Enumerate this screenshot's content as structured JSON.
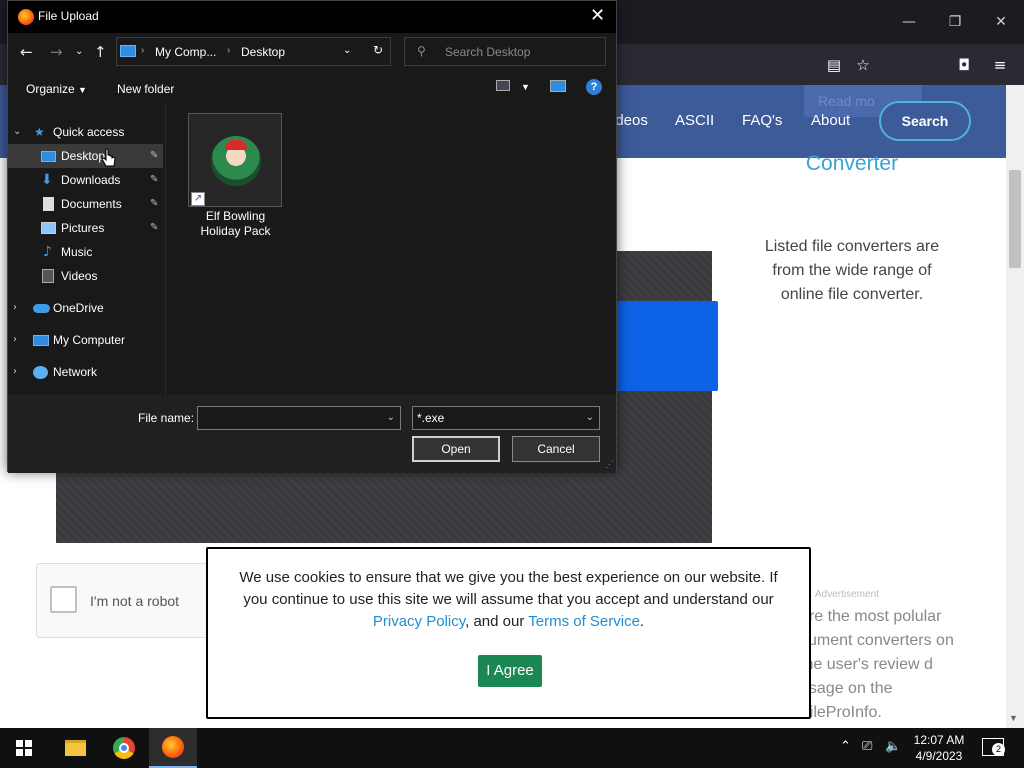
{
  "browser": {
    "window_controls": {
      "minimize": "—",
      "restore": "❐",
      "close": "✕"
    },
    "toolbar_icons": [
      "reader-view-icon",
      "bookmark-star-icon",
      "pocket-icon",
      "menu-icon"
    ]
  },
  "site": {
    "ghost_button": "Read mo",
    "nav": [
      "ideos",
      "ASCII",
      "FAQ's",
      "About"
    ],
    "search_label": "Search",
    "hero_title": "Converter",
    "hero_text": "Listed file converters are from the wide range of online file converter.",
    "ad_label": "Advertisement",
    "ad_text": "are the most polular cument converters on the user's review d usage on the FileProInfo.",
    "recaptcha_label": "I'm not a robot"
  },
  "cookie": {
    "text_part1": "We use cookies to ensure that we give you the best experience on our website. If you continue to use this site we will assume that you accept and understand our ",
    "privacy_link": "Privacy Policy",
    "text_part2": ", and our ",
    "terms_link": "Terms of Service",
    "text_part3": ".",
    "agree_label": "I Agree"
  },
  "dialog": {
    "title": "File Upload",
    "breadcrumb": [
      "My Comp...",
      "Desktop"
    ],
    "search_placeholder": "Search Desktop",
    "organize_label": "Organize",
    "new_folder_label": "New folder",
    "sidebar": [
      {
        "label": "Quick access",
        "icon": "star-icon",
        "level": 0,
        "expanded": true
      },
      {
        "label": "Desktop",
        "icon": "desktop-icon",
        "level": 1,
        "pinned": true,
        "selected": true
      },
      {
        "label": "Downloads",
        "icon": "download-icon",
        "level": 1,
        "pinned": true
      },
      {
        "label": "Documents",
        "icon": "document-icon",
        "level": 1,
        "pinned": true
      },
      {
        "label": "Pictures",
        "icon": "picture-icon",
        "level": 1,
        "pinned": true
      },
      {
        "label": "Music",
        "icon": "music-icon",
        "level": 1
      },
      {
        "label": "Videos",
        "icon": "video-icon",
        "level": 1
      },
      {
        "label": "OneDrive",
        "icon": "cloud-icon",
        "level": 0
      },
      {
        "label": "My Computer",
        "icon": "computer-icon",
        "level": 0
      },
      {
        "label": "Network",
        "icon": "network-icon",
        "level": 0
      }
    ],
    "file": {
      "name_line1": "Elf Bowling",
      "name_line2": "Holiday Pack"
    },
    "file_name_label": "File name:",
    "file_name_value": "",
    "file_type": "*.exe",
    "open_label": "Open",
    "cancel_label": "Cancel"
  },
  "taskbar": {
    "time": "12:07 AM",
    "date": "4/9/2023",
    "notification_count": "2"
  },
  "colors": {
    "site_header": "#3d5a99",
    "accent_link": "#1f8fcf",
    "agree_button": "#1b8753",
    "dialog_bg": "#191919"
  }
}
